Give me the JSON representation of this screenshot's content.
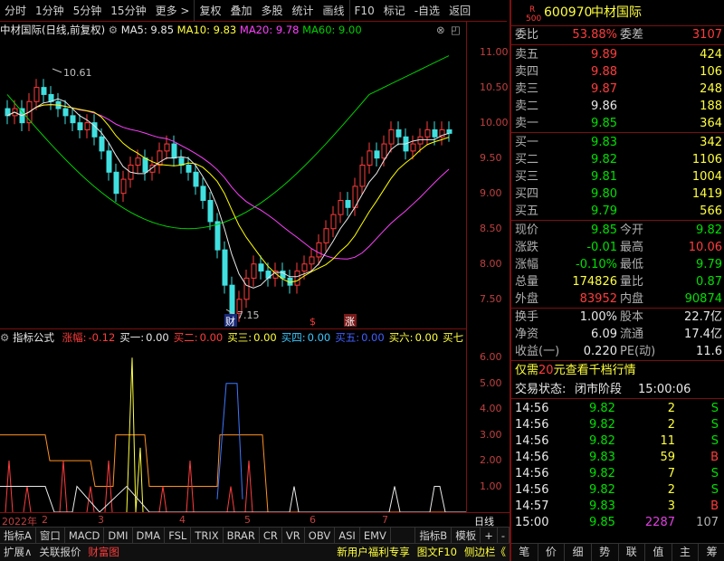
{
  "toolbar": {
    "items": [
      "分时",
      "1分钟",
      "5分钟",
      "15分钟",
      "更多 >",
      "复权",
      "叠加",
      "多股",
      "统计",
      "画线",
      "F10",
      "标记",
      "-自选",
      "返回"
    ]
  },
  "chart": {
    "title_name": "中材国际(日线,前复权)",
    "ma5": "MA5: 9.85",
    "ma10": "MA10: 9.83",
    "ma20": "MA20: 9.78",
    "ma60": "MA60: 9.00",
    "high_label": "10.61",
    "low_label": "7.15",
    "marker_cai": "财",
    "marker_zhang": "涨",
    "colors": {
      "ma5": "#e8e8e8",
      "ma10": "#ffff00",
      "ma20": "#ff40ff",
      "ma60": "#00d000",
      "up": "#ff3c3c",
      "down": "#40e0e0"
    }
  },
  "y_axis_main": [
    "11.00",
    "10.50",
    "10.00",
    "9.50",
    "9.00",
    "8.50",
    "8.00",
    "7.50"
  ],
  "indicator": {
    "name": "指标公式",
    "items": [
      {
        "label": "涨幅:",
        "value": "-0.12",
        "color": "#ff3c3c"
      },
      {
        "label": "买一:",
        "value": "0.00",
        "color": "#e8e8e8"
      },
      {
        "label": "买二:",
        "value": "0.00",
        "color": "#ff3c3c"
      },
      {
        "label": "买三:",
        "value": "0.00",
        "color": "#ffff3c"
      },
      {
        "label": "买四:",
        "value": "0.00",
        "color": "#3cc8ff"
      },
      {
        "label": "买五:",
        "value": "0.00",
        "color": "#4060ff"
      },
      {
        "label": "买六:",
        "value": "0.00",
        "color": "#ffff3c"
      },
      {
        "label": "买七",
        "value": "",
        "color": "#ffff3c"
      }
    ]
  },
  "y_axis_ind": [
    "6.00",
    "5.00",
    "4.00",
    "3.00",
    "2.00",
    "1.00"
  ],
  "date_axis": {
    "labels": [
      "2022年",
      "2",
      "3",
      "4",
      "5",
      "6",
      "7"
    ],
    "right": "日线"
  },
  "tabs": [
    "指标A",
    "窗口",
    "MACD",
    "DMI",
    "DMA",
    "FSL",
    "TRIX",
    "BRAR",
    "CR",
    "VR",
    "OBV",
    "ASI",
    "EMV",
    "",
    "指标B",
    "模板",
    "+",
    "-"
  ],
  "statusbar": {
    "left": [
      "扩展∧",
      "关联报价",
      "财富图"
    ],
    "right": [
      "新用户福利专享",
      "图文F10",
      "侧边栏《"
    ]
  },
  "quote": {
    "tag_r": "R",
    "tag_500": "500",
    "code": "600970",
    "name": "中材国际",
    "weibi_label": "委比",
    "weibi": "53.88%",
    "weicha_label": "委差",
    "weicha": "3107",
    "asks": [
      {
        "label": "卖五",
        "price": "9.89",
        "vol": "424",
        "pc": "c-red"
      },
      {
        "label": "卖四",
        "price": "9.88",
        "vol": "106",
        "pc": "c-red"
      },
      {
        "label": "卖三",
        "price": "9.87",
        "vol": "248",
        "pc": "c-red"
      },
      {
        "label": "卖二",
        "price": "9.86",
        "vol": "188",
        "pc": "c-white"
      },
      {
        "label": "卖一",
        "price": "9.85",
        "vol": "364",
        "pc": "c-green"
      }
    ],
    "bids": [
      {
        "label": "买一",
        "price": "9.83",
        "vol": "342",
        "pc": "c-green"
      },
      {
        "label": "买二",
        "price": "9.82",
        "vol": "1106",
        "pc": "c-green"
      },
      {
        "label": "买三",
        "price": "9.81",
        "vol": "1004",
        "pc": "c-green"
      },
      {
        "label": "买四",
        "price": "9.80",
        "vol": "1419",
        "pc": "c-green"
      },
      {
        "label": "买五",
        "price": "9.79",
        "vol": "566",
        "pc": "c-green"
      }
    ],
    "stats": [
      {
        "l1": "现价",
        "v1": "9.85",
        "c1": "c-green",
        "l2": "今开",
        "v2": "9.82",
        "c2": "c-green"
      },
      {
        "l1": "涨跌",
        "v1": "-0.01",
        "c1": "c-green",
        "l2": "最高",
        "v2": "10.06",
        "c2": "c-red"
      },
      {
        "l1": "涨幅",
        "v1": "-0.10%",
        "c1": "c-green",
        "l2": "最低",
        "v2": "9.79",
        "c2": "c-green"
      },
      {
        "l1": "总量",
        "v1": "174826",
        "c1": "c-yellow",
        "l2": "量比",
        "v2": "0.87",
        "c2": "c-green"
      },
      {
        "l1": "外盘",
        "v1": "83952",
        "c1": "c-red",
        "l2": "内盘",
        "v2": "90874",
        "c2": "c-green"
      }
    ],
    "stats2": [
      {
        "l1": "换手",
        "v1": "1.00%",
        "l2": "股本",
        "v2": "22.7亿"
      },
      {
        "l1": "净资",
        "v1": "6.09",
        "l2": "流通",
        "v2": "17.4亿"
      },
      {
        "l1": "收益(一)",
        "v1": "0.220",
        "l2": "PE(动)",
        "v2": "11.6"
      }
    ],
    "promo_pre": "仅需",
    "promo_num": "20",
    "promo_post": "元查看千档行情",
    "trade_status_label": "交易状态:",
    "trade_status": "闭市阶段",
    "trade_time": "15:00:06",
    "ticks": [
      {
        "time": "14:56",
        "price": "9.82",
        "vol": "2",
        "bs": "S",
        "vc": "c-yellow"
      },
      {
        "time": "14:56",
        "price": "9.82",
        "vol": "2",
        "bs": "S",
        "vc": "c-yellow"
      },
      {
        "time": "14:56",
        "price": "9.82",
        "vol": "11",
        "bs": "S",
        "vc": "c-yellow"
      },
      {
        "time": "14:56",
        "price": "9.83",
        "vol": "59",
        "bs": "B",
        "vc": "c-yellow"
      },
      {
        "time": "14:56",
        "price": "9.82",
        "vol": "7",
        "bs": "S",
        "vc": "c-yellow"
      },
      {
        "time": "14:56",
        "price": "9.82",
        "vol": "2",
        "bs": "S",
        "vc": "c-yellow"
      },
      {
        "time": "14:57",
        "price": "9.83",
        "vol": "3",
        "bs": "B",
        "vc": "c-yellow"
      },
      {
        "time": "15:00",
        "price": "9.85",
        "vol": "2287",
        "bs": "107",
        "vc": "c-purple"
      }
    ],
    "nav": [
      "笔",
      "价",
      "细",
      "势",
      "联",
      "值",
      "主",
      "筹"
    ]
  }
}
